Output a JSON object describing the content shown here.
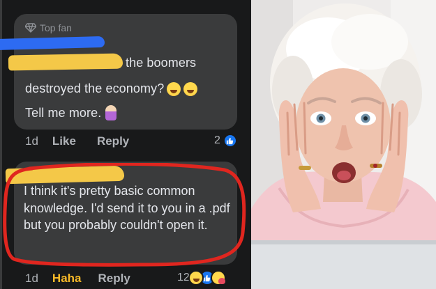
{
  "comment1": {
    "badge": "Top fan",
    "line1": "the boomers",
    "line2": "destroyed the economy?",
    "line3": "Tell me more.",
    "meta": {
      "age": "1d",
      "like": "Like",
      "reply": "Reply"
    },
    "reaction_count": "2"
  },
  "comment2": {
    "text": "I think it's pretty basic common knowledge. I'd send it to you in a .pdf but you probably couldn't open it.",
    "meta": {
      "age": "1d",
      "reaction": "Haha",
      "reply": "Reply"
    },
    "reaction_count": "12"
  },
  "colors": {
    "background": "#18191a",
    "bubble": "#3a3b3c",
    "text": "#e4e6eb",
    "muted": "#b0b3b8",
    "haha": "#f7b928",
    "like_blue": "#1877f2",
    "highlight_red": "#e0261f",
    "redact_yellow": "#f4c848",
    "redact_blue": "#2d6bf2"
  },
  "icons": [
    "diamond-icon",
    "joy-emoji-icon",
    "shrug-emoji-icon",
    "like-reaction-icon",
    "haha-reaction-icon",
    "care-reaction-icon"
  ]
}
